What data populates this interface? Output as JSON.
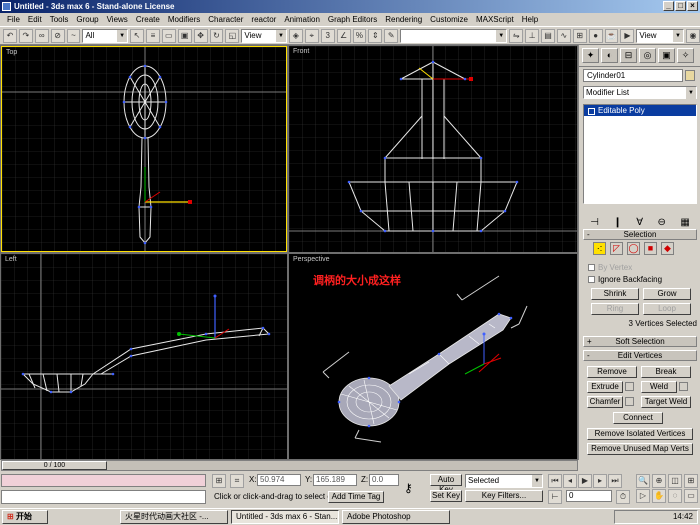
{
  "window": {
    "title": "Untitled - 3ds max 6 - Stand-alone License"
  },
  "menu": [
    "File",
    "Edit",
    "Tools",
    "Group",
    "Views",
    "Create",
    "Modifiers",
    "Character",
    "reactor",
    "Animation",
    "Graph Editors",
    "Rendering",
    "Customize",
    "MAXScript",
    "Help"
  ],
  "toolbar": {
    "selection_filter": "All",
    "ref_coord": "View",
    "ref_coord_right": "View",
    "named_selection": ""
  },
  "viewports": {
    "top": "Top",
    "front": "Front",
    "left": "Left",
    "perspective": "Perspective",
    "annotation": "调柄的大小成这样"
  },
  "command_panel": {
    "object_name": "Cylinder01",
    "modifier_list": "Modifier List",
    "stack_item": "Editable Poly",
    "selection_rollout": "Selection",
    "by_vertex": "By Vertex",
    "ignore_backfacing": "Ignore Backfacing",
    "shrink": "Shrink",
    "grow": "Grow",
    "ring": "Ring",
    "loop": "Loop",
    "selection_status": "3 Vertices Selected",
    "soft_selection": "Soft Selection",
    "edit_vertices": "Edit Vertices",
    "remove": "Remove",
    "break": "Break",
    "extrude": "Extrude",
    "weld": "Weld",
    "chamfer": "Chamfer",
    "target_weld": "Target Weld",
    "connect": "Connect",
    "remove_isolated": "Remove Isolated Vertices",
    "remove_unused": "Remove Unused Map Verts"
  },
  "bottom": {
    "time_slider": "0 / 100",
    "x_label": "X:",
    "x_value": "50.974",
    "y_label": "Y:",
    "y_value": "165.189",
    "z_label": "Z:",
    "z_value": "0.0",
    "auto_key": "Auto Key",
    "auto_key_mode": "Selected",
    "set_key": "Set Key",
    "key_filters": "Key Filters...",
    "frame": "0",
    "prompt": "Click or click-and-drag to select obj",
    "add_time_tag": "Add Time Tag"
  },
  "taskbar": {
    "start": "开始",
    "tasks": [
      "火星时代动画大社区 -...",
      "Untitled - 3ds max 6 - Stan...",
      "Adobe Photoshop"
    ],
    "clock": "14:42"
  }
}
